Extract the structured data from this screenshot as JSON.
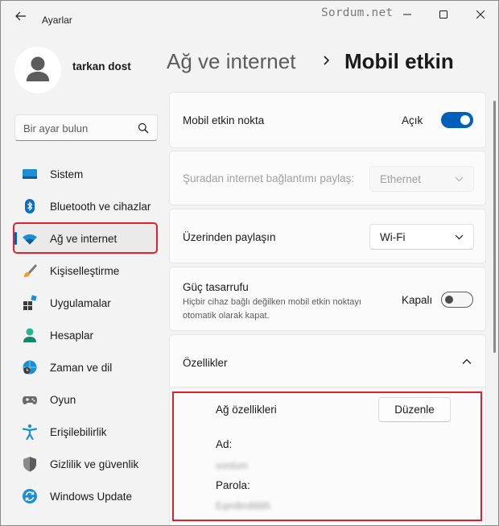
{
  "window": {
    "title": "Ayarlar",
    "watermark": "Sordum.net"
  },
  "user": {
    "name": "tarkan dost"
  },
  "search": {
    "placeholder": "Bir ayar bulun"
  },
  "sidebar": {
    "items": [
      {
        "label": "Sistem",
        "icon": "system-monitor-icon"
      },
      {
        "label": "Bluetooth ve cihazlar",
        "icon": "bluetooth-icon"
      },
      {
        "label": "Ağ ve internet",
        "icon": "wifi-network-icon",
        "active": true
      },
      {
        "label": "Kişiselleştirme",
        "icon": "paintbrush-icon"
      },
      {
        "label": "Uygulamalar",
        "icon": "apps-icon"
      },
      {
        "label": "Hesaplar",
        "icon": "account-person-icon"
      },
      {
        "label": "Zaman ve dil",
        "icon": "globe-clock-icon"
      },
      {
        "label": "Oyun",
        "icon": "gamepad-icon"
      },
      {
        "label": "Erişilebilirlik",
        "icon": "accessibility-icon"
      },
      {
        "label": "Gizlilik ve güvenlik",
        "icon": "shield-icon"
      },
      {
        "label": "Windows Update",
        "icon": "windows-update-icon"
      }
    ]
  },
  "header": {
    "parent": "Ağ ve internet",
    "separator": "›",
    "current": "Mobil etkin"
  },
  "settings": {
    "hotspot": {
      "label": "Mobil etkin nokta",
      "state_text": "Açık",
      "on": true
    },
    "share_from": {
      "label": "Şuradan internet bağlantımı paylaş:",
      "value": "Ethernet",
      "disabled": true
    },
    "share_over": {
      "label": "Üzerinden paylaşın",
      "value": "Wi-Fi"
    },
    "power_saving": {
      "label": "Güç tasarrufu",
      "description": "Hiçbir cihaz bağlı değilken mobil etkin noktayı otomatik olarak kapat.",
      "state_text": "Kapalı",
      "on": false
    },
    "properties": {
      "label": "Özellikler",
      "expanded": true,
      "network_title": "Ağ özellikleri",
      "edit_label": "Düzenle",
      "name_label": "Ad:",
      "name_value": "sordum",
      "password_label": "Parola:",
      "password_value": "Eqm8m8885"
    }
  },
  "colors": {
    "accent": "#005fb8",
    "highlight_box": "#e0202b"
  }
}
